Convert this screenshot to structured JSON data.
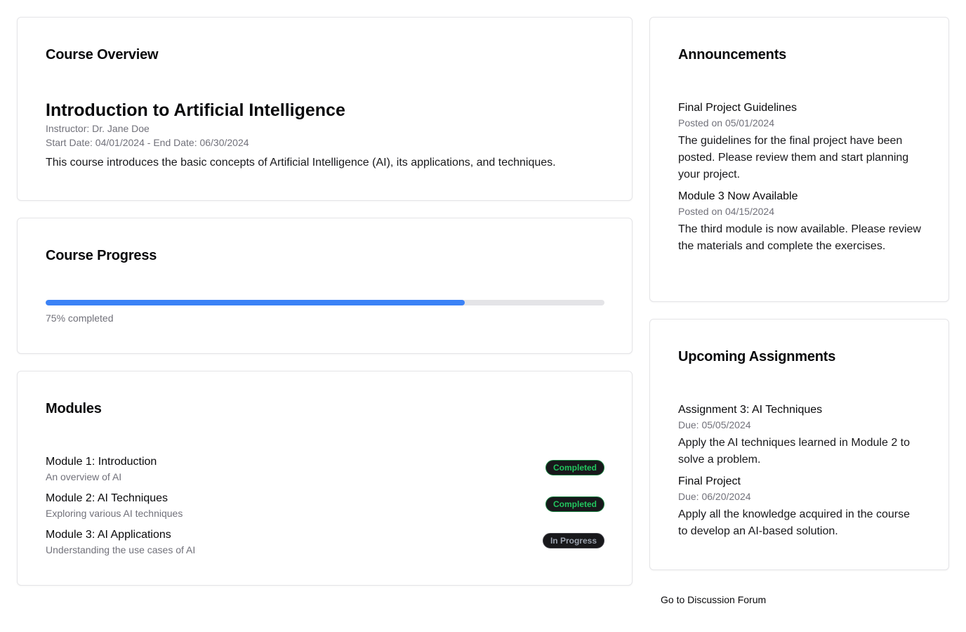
{
  "overview": {
    "title": "Course Overview",
    "course_name": "Introduction to Artificial Intelligence",
    "instructor": "Instructor: Dr. Jane Doe",
    "dates": "Start Date: 04/01/2024 - End Date: 06/30/2024",
    "description": "This course introduces the basic concepts of Artificial Intelligence (AI), its applications, and techniques."
  },
  "progress": {
    "title": "Course Progress",
    "percent": 75,
    "label": "75% completed"
  },
  "modules": {
    "title": "Modules",
    "items": [
      {
        "title": "Module 1: Introduction",
        "subtitle": "An overview of AI",
        "status": "Completed"
      },
      {
        "title": "Module 2: AI Techniques",
        "subtitle": "Exploring various AI techniques",
        "status": "Completed"
      },
      {
        "title": "Module 3: AI Applications",
        "subtitle": "Understanding the use cases of AI",
        "status": "In Progress"
      }
    ]
  },
  "announcements": {
    "title": "Announcements",
    "items": [
      {
        "title": "Final Project Guidelines",
        "date": "Posted on 05/01/2024",
        "body": "The guidelines for the final project have been posted. Please review them and start planning your project."
      },
      {
        "title": "Module 3 Now Available",
        "date": "Posted on 04/15/2024",
        "body": "The third module is now available. Please review the materials and complete the exercises."
      }
    ]
  },
  "assignments": {
    "title": "Upcoming Assignments",
    "items": [
      {
        "title": "Assignment 3: AI Techniques",
        "due": "Due: 05/05/2024",
        "body": "Apply the AI techniques learned in Module 2 to solve a problem."
      },
      {
        "title": "Final Project",
        "due": "Due: 06/20/2024",
        "body": "Apply all the knowledge acquired in the course to develop an AI-based solution."
      }
    ]
  },
  "forum_link": "Go to Discussion Forum",
  "colors": {
    "accent": "#3b82f6",
    "track": "#e4e4e7",
    "badge_completed": "#22c55e",
    "badge_in_progress": "#9ca3af"
  }
}
